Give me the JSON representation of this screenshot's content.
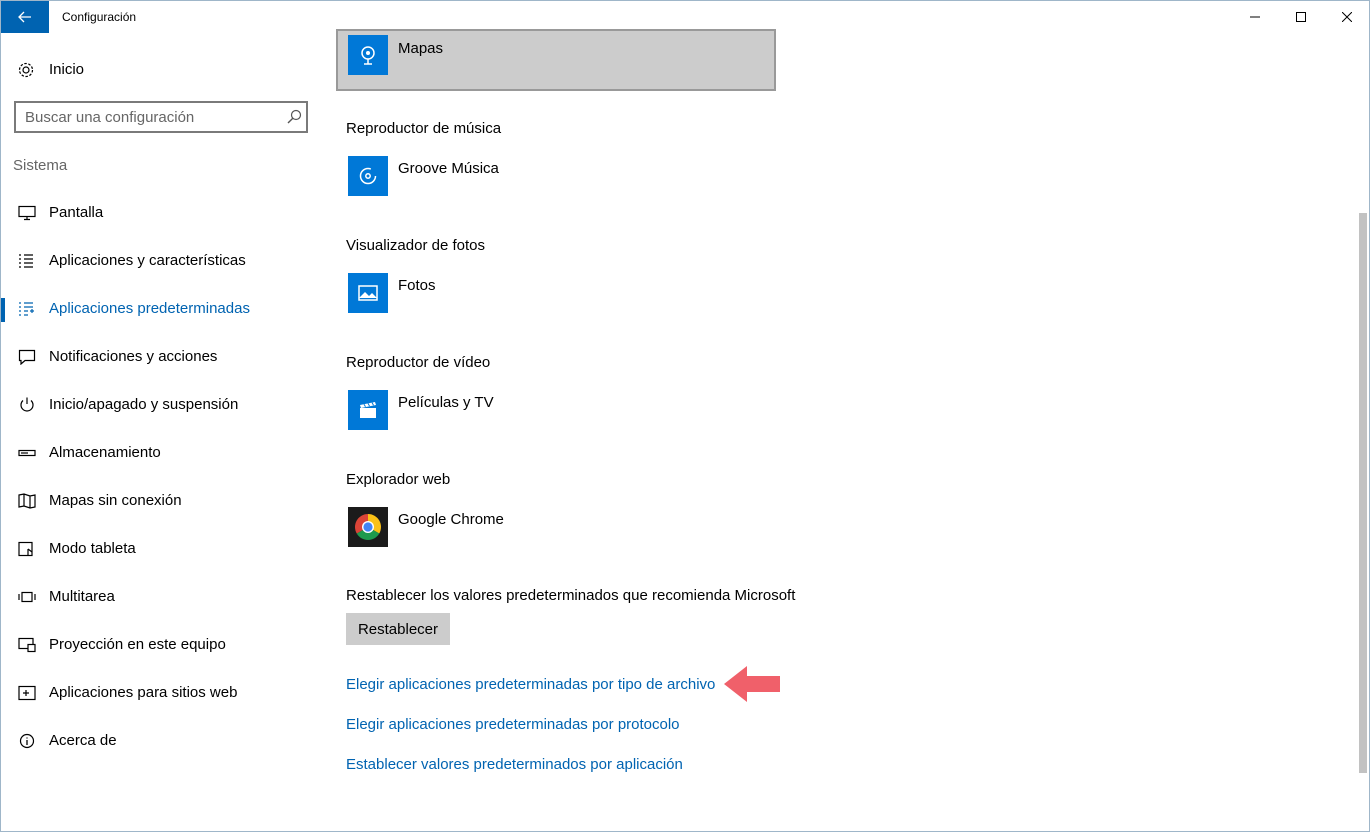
{
  "window": {
    "title": "Configuración"
  },
  "sidebar": {
    "home_label": "Inicio",
    "search_placeholder": "Buscar una configuración",
    "section": "Sistema",
    "items": [
      {
        "label": "Pantalla",
        "icon": "monitor-icon"
      },
      {
        "label": "Aplicaciones y características",
        "icon": "list-icon"
      },
      {
        "label": "Aplicaciones predeterminadas",
        "icon": "default-apps-icon",
        "active": true
      },
      {
        "label": "Notificaciones y acciones",
        "icon": "notification-icon"
      },
      {
        "label": "Inicio/apagado y suspensión",
        "icon": "power-icon"
      },
      {
        "label": "Almacenamiento",
        "icon": "storage-icon"
      },
      {
        "label": "Mapas sin conexión",
        "icon": "map-icon"
      },
      {
        "label": "Modo tableta",
        "icon": "tablet-icon"
      },
      {
        "label": "Multitarea",
        "icon": "multitask-icon"
      },
      {
        "label": "Proyección en este equipo",
        "icon": "projection-icon"
      },
      {
        "label": "Aplicaciones para sitios web",
        "icon": "web-apps-icon"
      },
      {
        "label": "Acerca de",
        "icon": "info-icon"
      }
    ]
  },
  "content": {
    "maps_app": "Mapas",
    "categories": [
      {
        "label": "Reproductor de música",
        "app": "Groove Música",
        "icon": "groove-icon"
      },
      {
        "label": "Visualizador de fotos",
        "app": "Fotos",
        "icon": "photos-icon"
      },
      {
        "label": "Reproductor de vídeo",
        "app": "Películas y TV",
        "icon": "movies-icon"
      },
      {
        "label": "Explorador web",
        "app": "Google Chrome",
        "icon": "chrome-icon"
      }
    ],
    "reset_description": "Restablecer los valores predeterminados que recomienda Microsoft",
    "reset_button": "Restablecer",
    "links": [
      "Elegir aplicaciones predeterminadas por tipo de archivo",
      "Elegir aplicaciones predeterminadas por protocolo",
      "Establecer valores predeterminados por aplicación"
    ]
  },
  "colors": {
    "accent": "#0063b1",
    "tile_blue": "#0078d7",
    "arrow": "#f0606a"
  }
}
